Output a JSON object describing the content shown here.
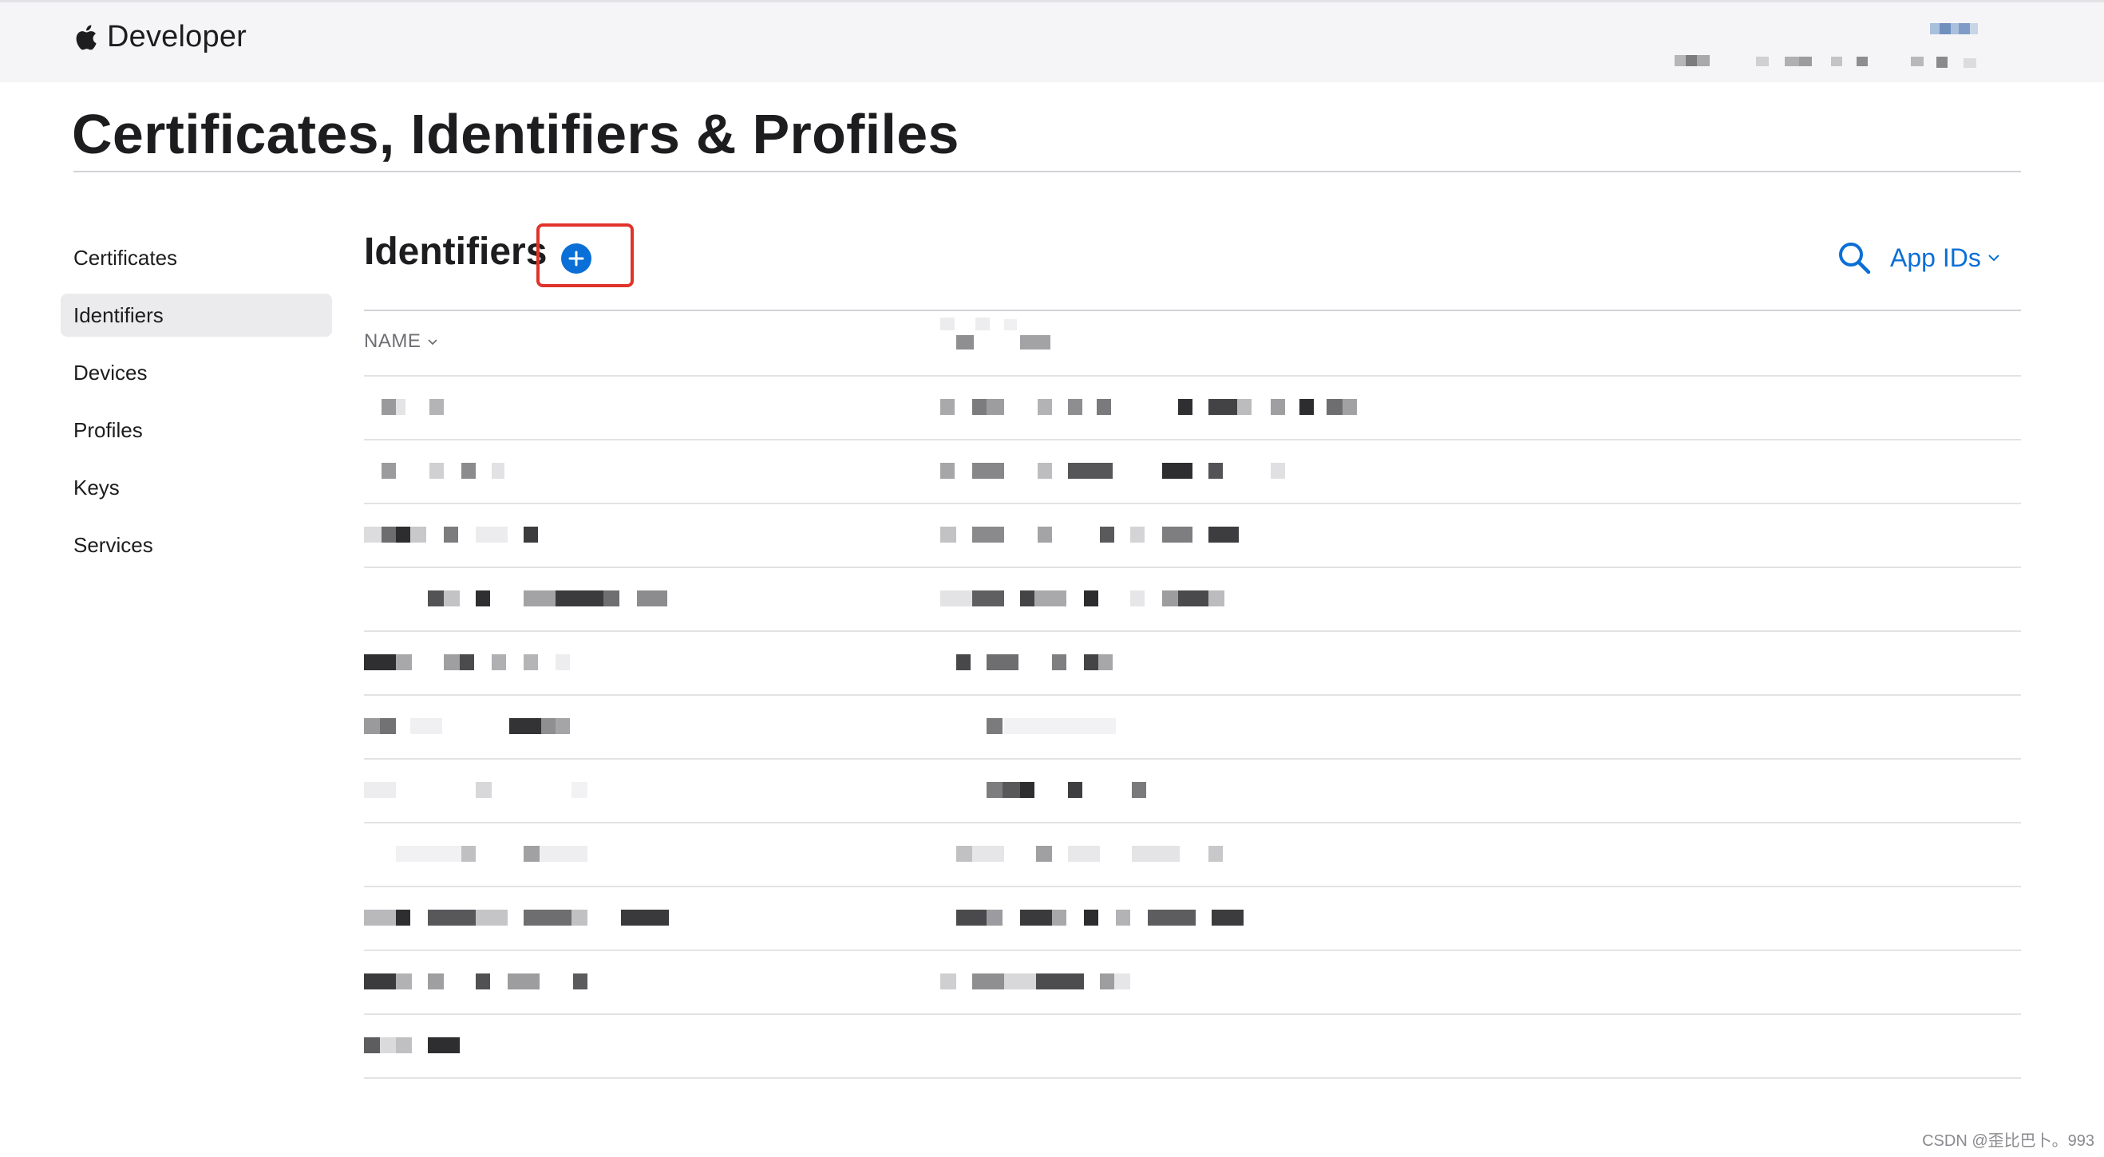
{
  "nav": {
    "brand": "Developer"
  },
  "page": {
    "title": "Certificates, Identifiers & Profiles"
  },
  "sidebar": {
    "items": [
      {
        "label": "Certificates"
      },
      {
        "label": "Identifiers"
      },
      {
        "label": "Devices"
      },
      {
        "label": "Profiles"
      },
      {
        "label": "Keys"
      },
      {
        "label": "Services"
      }
    ],
    "active": "Identifiers"
  },
  "section": {
    "title": "Identifiers",
    "filter_label": "App IDs"
  },
  "table": {
    "columns": {
      "name_header": "NAME"
    }
  },
  "watermark": "CSDN @歪比巴卜。993",
  "colors": {
    "accent": "#0a6fd6",
    "highlight": "#e0332b",
    "nav_bg": "#f5f5f7"
  },
  "icons": [
    "apple-logo-icon",
    "add-circle-icon",
    "search-icon",
    "chevron-down-icon"
  ]
}
